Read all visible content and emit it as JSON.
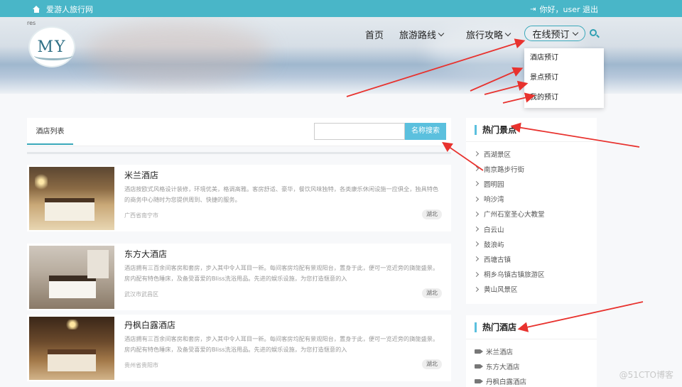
{
  "topbar": {
    "site_name": "爱游人旅行网",
    "user_text": "你好，user 退出"
  },
  "logo": {
    "text": "MY",
    "corner": "res"
  },
  "nav": {
    "home": "首页",
    "routes": "旅游路线",
    "guide": "旅行攻略",
    "booking": "在线预订"
  },
  "dropdown": {
    "items": [
      "酒店预订",
      "景点预订",
      "我的预订"
    ]
  },
  "main": {
    "tab": "酒店列表",
    "search_button": "名称搜索",
    "search_placeholder": "",
    "hotels": [
      {
        "name": "米兰酒店",
        "desc": "酒店按欧式风格设计装修，环境优美，格调高雅。客房舒适、豪华，餐饮风味独特，各类康乐休闲设施一应俱全，独具特色的商务中心随时为您提供周到、快捷的服务。",
        "location": "广西省南宁市",
        "tag": "湖北"
      },
      {
        "name": "东方大酒店",
        "desc": "酒店拥有三百余间客房和套房，步入其中令人耳目一新。每间客房均配有景观阳台，置身于此，便可一览近旁的旖旎盛景。房内配有特色睡床，及备受喜爱的Bliss洗浴用品。先进的娱乐设施，为您打造惬意的入",
        "location": "武汉市武昌区",
        "tag": "湖北"
      },
      {
        "name": "丹枫白露酒店",
        "desc": "酒店拥有三百余间客房和套房，步入其中令人耳目一新。每间客房均配有景观阳台，置身于此，便可一览近旁的旖旎盛景。房内配有特色睡床，及备受喜爱的Bliss洗浴用品。先进的娱乐设施，为您打造惬意的入",
        "location": "贵州省贵阳市",
        "tag": "湖北"
      }
    ]
  },
  "sidebar": {
    "scenic_title": "热门景点",
    "scenic": [
      "西湖景区",
      "南京路步行街",
      "圆明园",
      "响沙湾",
      "广州石室圣心大教堂",
      "白云山",
      "鼓浪屿",
      "西塘古镇",
      "桐乡乌镇古镇旅游区",
      "黄山风景区"
    ],
    "hotels_title": "热门酒店",
    "hotels": [
      "米兰酒店",
      "东方大酒店",
      "丹枫白露酒店"
    ]
  },
  "watermark": "@51CTO博客",
  "colors": {
    "accent": "#49b6c8",
    "button": "#5bc0de",
    "arrow": "#e8322e"
  }
}
